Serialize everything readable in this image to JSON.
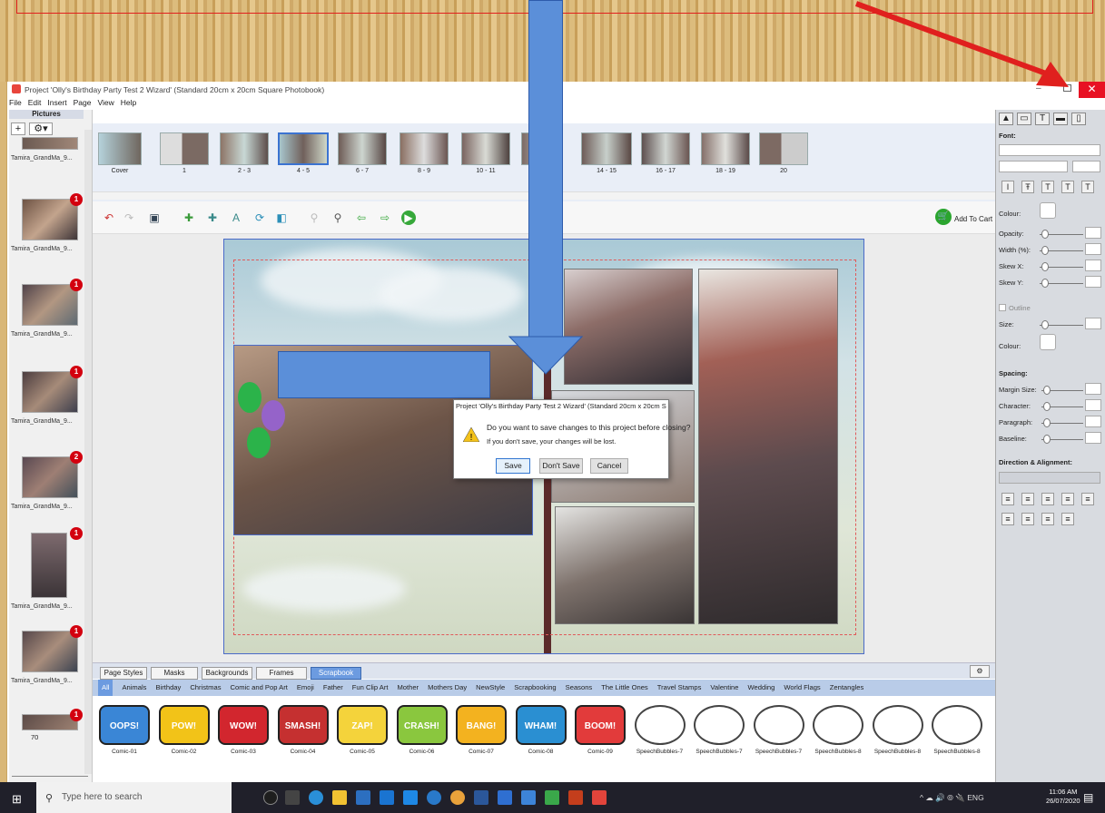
{
  "window": {
    "title": "Project 'Olly's Birthday Party Test 2 Wizard' (Standard 20cm x 20cm Square Photobook)",
    "minimize": "–",
    "close": "✕"
  },
  "menu": [
    "File",
    "Edit",
    "Insert",
    "Page",
    "View",
    "Help"
  ],
  "pictures": {
    "header": "Pictures",
    "add": "+",
    "settings": "⚙▾",
    "count": "70",
    "items": [
      {
        "label": "Tamira_GrandMa_9...",
        "badge": ""
      },
      {
        "label": "Tamira_GrandMa_9...",
        "badge": "1"
      },
      {
        "label": "Tamira_GrandMa_9...",
        "badge": "1"
      },
      {
        "label": "Tamira_GrandMa_9...",
        "badge": "1"
      },
      {
        "label": "Tamira_GrandMa_9...",
        "badge": "2"
      },
      {
        "label": "Tamira_GrandMa_9...",
        "badge": "1"
      },
      {
        "label": "Tamira_GrandMa_9...",
        "badge": "1"
      },
      {
        "label": "",
        "badge": "1"
      }
    ]
  },
  "pages": [
    "Cover",
    "1",
    "2 - 3",
    "4 - 5",
    "6 - 7",
    "8 - 9",
    "10 - 11",
    "",
    "14 - 15",
    "16 - 17",
    "18 - 19",
    "20"
  ],
  "toolbar": {
    "add_to_cart": "Add To Cart"
  },
  "dialog": {
    "title": "Project 'Olly's Birthday Party Test 2 Wizard' (Standard 20cm x 20cm Sq...",
    "question": "Do you want to save changes to this project before closing?",
    "note": "If you don't save, your changes will be lost.",
    "save": "Save",
    "dont_save": "Don't Save",
    "cancel": "Cancel"
  },
  "bottom_tabs": [
    "Page Styles",
    "Masks",
    "Backgrounds",
    "Frames",
    "Scrapbook"
  ],
  "categories": [
    "All",
    "Animals",
    "Birthday",
    "Christmas",
    "Comic and Pop Art",
    "Emoji",
    "Father",
    "Fun Clip Art",
    "Mother",
    "Mothers Day",
    "NewStyle",
    "Scrapbooking",
    "Seasons",
    "The Little Ones",
    "Travel Stamps",
    "Valentine",
    "Wedding",
    "World Flags",
    "Zentangles"
  ],
  "stickers": [
    {
      "label": "Comic-01",
      "text": "OOPS!",
      "color": "#3a86d6"
    },
    {
      "label": "Comic-02",
      "text": "POW!",
      "color": "#f2c318"
    },
    {
      "label": "Comic-03",
      "text": "WOW!",
      "color": "#d2262e"
    },
    {
      "label": "Comic-04",
      "text": "SMASH!",
      "color": "#c53030"
    },
    {
      "label": "Comic-05",
      "text": "ZAP!",
      "color": "#f4d33b"
    },
    {
      "label": "Comic-06",
      "text": "CRASH!",
      "color": "#8ac73e"
    },
    {
      "label": "Comic-07",
      "text": "BANG!",
      "color": "#f3b21f"
    },
    {
      "label": "Comic-08",
      "text": "WHAM!",
      "color": "#2a8fd2"
    },
    {
      "label": "Comic-09",
      "text": "BOOM!",
      "color": "#e23b3b"
    },
    {
      "label": "SpeechBubbles-7",
      "text": "",
      "color": "#ffffff"
    },
    {
      "label": "SpeechBubbles-7",
      "text": "",
      "color": "#ffffff"
    },
    {
      "label": "SpeechBubbles-7",
      "text": "",
      "color": "#ffffff"
    },
    {
      "label": "SpeechBubbles-8",
      "text": "",
      "color": "#ffffff"
    },
    {
      "label": "SpeechBubbles-8",
      "text": "",
      "color": "#ffffff"
    },
    {
      "label": "SpeechBubbles-8",
      "text": "",
      "color": "#ffffff"
    }
  ],
  "right": {
    "font": "Font:",
    "colour": "Colour:",
    "opacity": "Opacity:",
    "width": "Width (%):",
    "skewx": "Skew X:",
    "skewy": "Skew Y:",
    "outline": "Outline",
    "size": "Size:",
    "colour2": "Colour:",
    "spacing": "Spacing:",
    "margin": "Margin Size:",
    "character": "Character:",
    "paragraph": "Paragraph:",
    "baseline": "Baseline:",
    "direction": "Direction & Alignment:"
  },
  "taskbar": {
    "search": "Type here to search",
    "lang": "ENG",
    "time": "11:06 AM",
    "date": "26/07/2020"
  },
  "colors": {
    "accent": "#5b8fd9",
    "annotation_red": "#e0201e",
    "tab_active": "#6c9be0"
  }
}
